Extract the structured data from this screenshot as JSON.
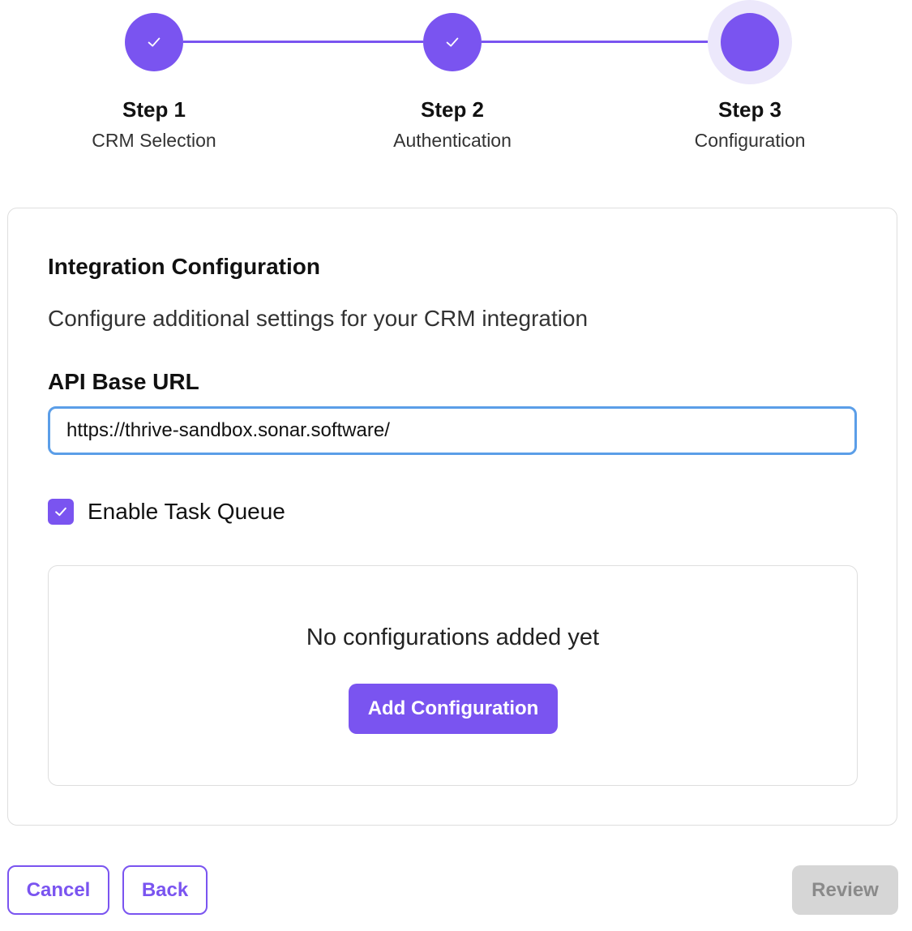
{
  "stepper": {
    "steps": [
      {
        "title": "Step 1",
        "subtitle": "CRM Selection",
        "status": "completed",
        "icon": "check-icon"
      },
      {
        "title": "Step 2",
        "subtitle": "Authentication",
        "status": "completed",
        "icon": "check-icon"
      },
      {
        "title": "Step 3",
        "subtitle": "Configuration",
        "status": "current",
        "icon": ""
      }
    ]
  },
  "card": {
    "title": "Integration Configuration",
    "description": "Configure additional settings for your CRM integration",
    "api_base_url": {
      "label": "API Base URL",
      "value": "https://thrive-sandbox.sonar.software/"
    },
    "task_queue": {
      "label": "Enable Task Queue",
      "checked": true
    },
    "configurations": {
      "empty_text": "No configurations added yet",
      "add_label": "Add Configuration"
    }
  },
  "footer": {
    "cancel_label": "Cancel",
    "back_label": "Back",
    "review_label": "Review"
  },
  "colors": {
    "accent": "#7a54f0",
    "focus_ring": "#5b9ee8",
    "disabled_bg": "#d6d6d6",
    "disabled_text": "#8a8a8a"
  }
}
